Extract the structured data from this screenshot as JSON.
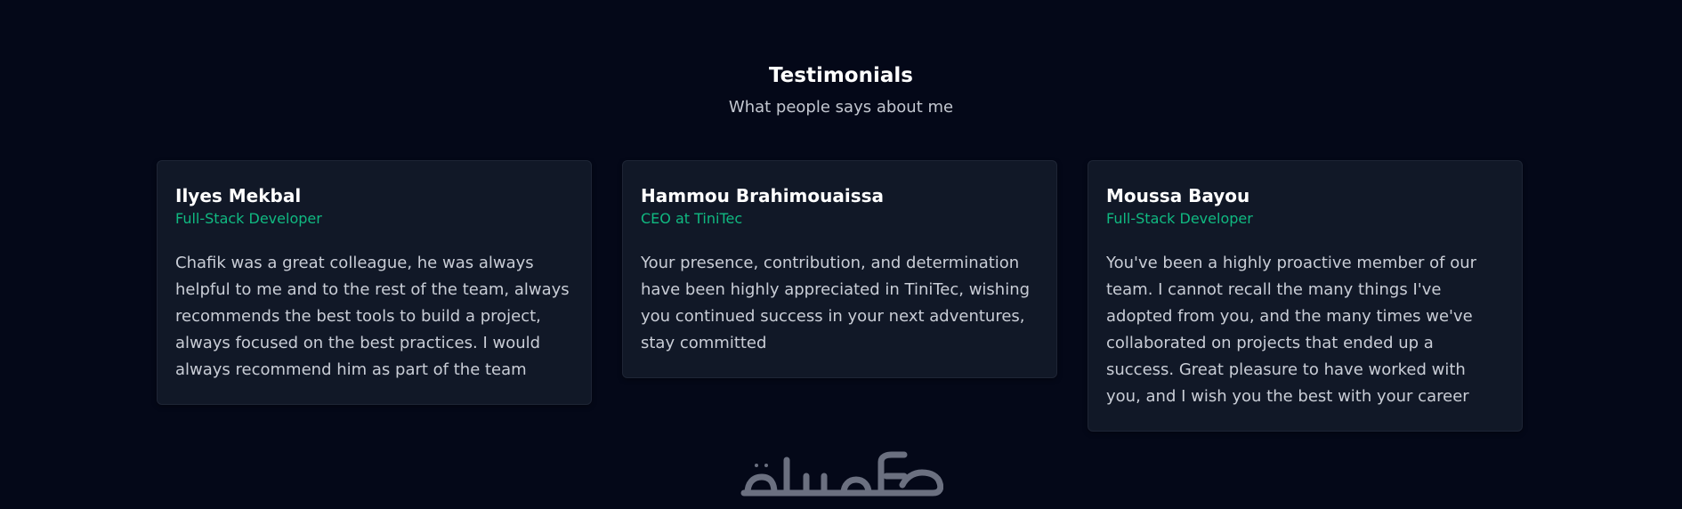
{
  "section": {
    "title": "Testimonials",
    "subtitle": "What people says about me"
  },
  "testimonials": [
    {
      "name": "Ilyes Mekbal",
      "role": "Full-Stack Developer",
      "text": "Chafik was a great colleague, he was always helpful to me and to the rest of the team, always recommends the best tools to build a project, always focused on the best practices. I would always recommend him as part of the team"
    },
    {
      "name": "Hammou Brahimouaissa",
      "role": "CEO at TiniTec",
      "text": "Your presence, contribution, and determination have been highly appreciated in TiniTec, wishing you continued success in your next adventures, stay committed"
    },
    {
      "name": "Moussa Bayou",
      "role": "Full-Stack Developer",
      "text": "You've been a highly proactive member of our team. I cannot recall the many things I've adopted from you, and the many times we've collaborated on projects that ended up a success. Great pleasure to have worked with you, and I wish you the best with your career"
    }
  ],
  "watermark": {
    "text": "خمسات"
  },
  "colors": {
    "background": "#040818",
    "card_background": "#111827",
    "accent": "#10b981"
  }
}
